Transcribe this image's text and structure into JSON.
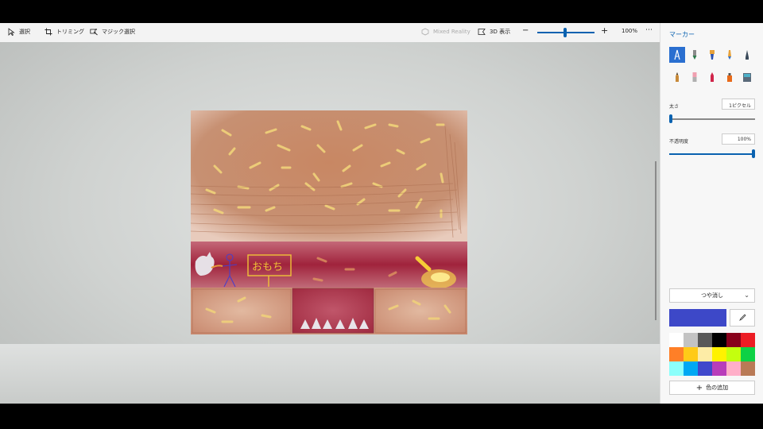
{
  "toolbar": {
    "select_label": "選択",
    "crop_label": "トリミング",
    "magic_select_label": "マジック選択",
    "mixed_reality_label": "Mixed Reality",
    "view3d_label": "3D 表示",
    "zoom_value": "100%",
    "zoom_level_fraction": 0.5,
    "more_label": "⋯"
  },
  "panel": {
    "title": "マーカー",
    "tools": [
      {
        "name": "calligraphy-pen",
        "selected": true
      },
      {
        "name": "oil-brush"
      },
      {
        "name": "watercolor"
      },
      {
        "name": "pixel-pen"
      },
      {
        "name": "pencil"
      },
      {
        "name": "eraser"
      },
      {
        "name": "crayon"
      },
      {
        "name": "spray-can"
      },
      {
        "name": "fill"
      },
      {
        "name": "bucket"
      }
    ],
    "size_label": "太さ",
    "size_value": "1ピクセル",
    "size_fraction": 0.0,
    "opacity_label": "不透明度",
    "opacity_value": "100%",
    "opacity_fraction": 1.0,
    "finish_label": "つや消し",
    "add_color_label": "色の追加",
    "current_color": "#3d48c8",
    "palette": [
      "#ffffff",
      "#c3c3c3",
      "#585858",
      "#000000",
      "#88001b",
      "#ec1c24",
      "#ff7f27",
      "#ffca18",
      "#fdeca6",
      "#fff200",
      "#c4ff0e",
      "#0ed145",
      "#8cfffb",
      "#00a8f3",
      "#3f48cc",
      "#b83dba",
      "#ffaec8",
      "#b97a56"
    ]
  },
  "canvas": {
    "sign_text": "おもち"
  },
  "colors": {
    "accent": "#0a62b0",
    "selected_tool": "#2a6fd0"
  }
}
